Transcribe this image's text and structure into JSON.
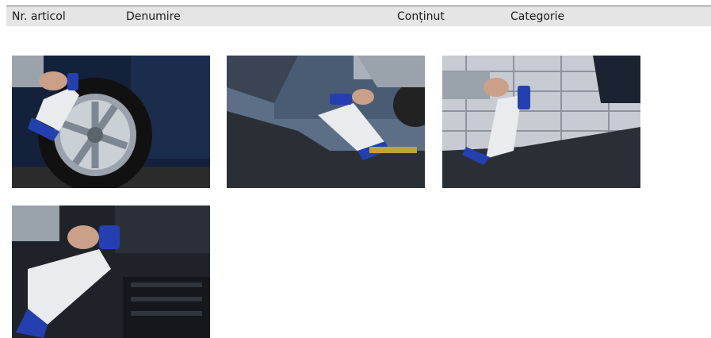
{
  "table": {
    "columns": {
      "article_no": "Nr. articol",
      "name": "Denumire",
      "content": "Conținut",
      "category": "Categorie"
    }
  },
  "gallery": {
    "images": [
      {
        "icon": "sprayer-on-wheel-image"
      },
      {
        "icon": "sprayer-engine-bay-image"
      },
      {
        "icon": "sprayer-engine-fence-image"
      },
      {
        "icon": "sprayer-engine-closeup-image"
      }
    ]
  },
  "colors": {
    "header_bg": "#e5e5e5",
    "header_border": "#6f6f6f",
    "sprayer_blue": "#2440b0",
    "sprayer_white": "#e8ecef"
  }
}
